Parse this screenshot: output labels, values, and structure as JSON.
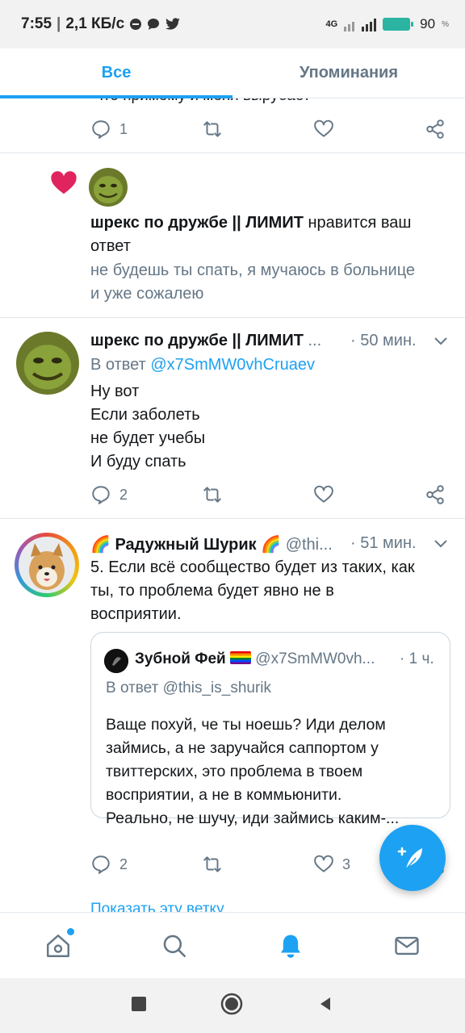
{
  "status": {
    "time": "7:55",
    "speed": "2,1 КБ/с",
    "network": "4G",
    "battery": "90"
  },
  "tabs": [
    {
      "label": "Все"
    },
    {
      "label": "Упоминания"
    }
  ],
  "clipped_text": "что примему и меня вырубает",
  "top_actions": {
    "reply_count": "1"
  },
  "notification": {
    "icon": "heart-icon",
    "name": "шрекс по дружбе || ЛИМИТ",
    "action_line1": "нравится ваш",
    "action_line2": "ответ",
    "quote_line1": "не будешь ты спать, я мучаюсь в больнице",
    "quote_line2": "и уже сожалею"
  },
  "tweet1": {
    "name": "шрекс по дружбе || ЛИМИТ",
    "ellipsis": "...",
    "time": "· 50 мин.",
    "reply_prefix": "В ответ",
    "reply_to": "@x7SmMW0vhCruaev",
    "lines": [
      "Ну вот",
      "Если заболеть",
      "не будет учебы",
      "И буду спать"
    ],
    "reply_count": "2"
  },
  "tweet2": {
    "name_prefix_emoji": "🌈",
    "name": "Радужный Шурик",
    "name_suffix_emoji": "🌈",
    "handle": "@thi...",
    "time": "· 51 мин.",
    "lines": [
      "5. Если всё сообщество будет из таких, как",
      "ты, то проблема будет явно не в",
      "восприятии."
    ],
    "quote": {
      "name": "Зубной Фей",
      "handle": "@x7SmMW0vh...",
      "time": "· 1 ч.",
      "reply_prefix": "В ответ",
      "reply_to": "@this_is_shurik",
      "lines": [
        "Ваще похуй, че ты ноешь? Иди делом",
        "займись, а не заручайся саппортом у",
        "твиттерских, это проблема в твоем",
        "восприятии, а не в коммьюнити.",
        "Реально, не шучу, иди займись каким-..."
      ]
    },
    "reply_count": "2",
    "like_count": "3"
  },
  "show_thread": "Показать эту ветку",
  "colors": {
    "accent": "#1da1f2",
    "heart": "#e0245e",
    "secondary_text": "#657786"
  }
}
